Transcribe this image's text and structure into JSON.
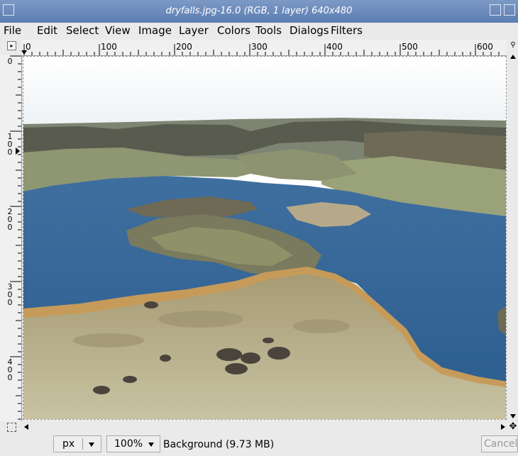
{
  "window": {
    "title": "dryfalls.jpg-16.0 (RGB, 1 layer) 640x480"
  },
  "menu": [
    "File",
    "Edit",
    "Select",
    "View",
    "Image",
    "Layer",
    "Colors",
    "Tools",
    "Dialogs",
    "Filters"
  ],
  "ruler": {
    "h_labels": [
      "0",
      "100",
      "200",
      "300",
      "400",
      "500",
      "600"
    ],
    "v_labels": [
      "0",
      "100",
      "200",
      "300",
      "400"
    ]
  },
  "status": {
    "unit": "px",
    "zoom": "100%",
    "layer_info": "Background (9.73 MB)",
    "cancel_label": "Cancel"
  },
  "icons": {
    "menu_arrow": "menu-arrow-icon",
    "quick_mask": "quick-mask-icon",
    "navigate": "navigate-icon",
    "zoom": "zoom-icon"
  }
}
